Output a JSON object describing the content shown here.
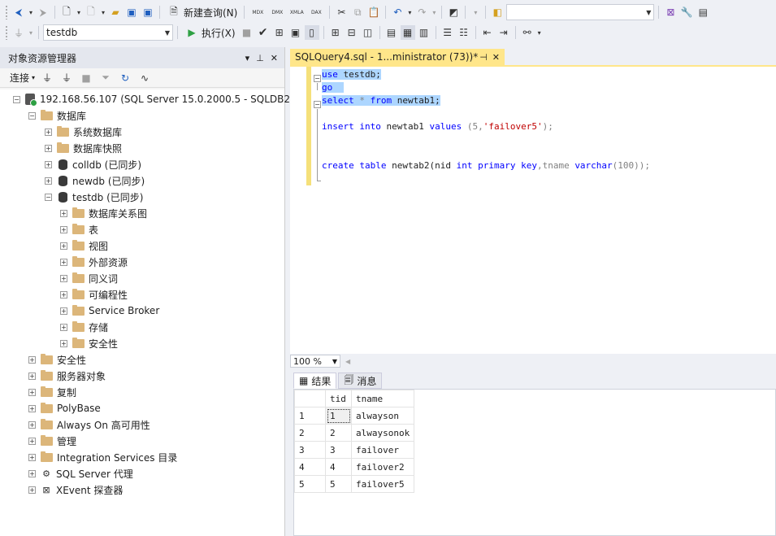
{
  "toolbar1": {
    "new_query_label": "新建查询(N)",
    "file_buttons": [
      "MDX",
      "DMX",
      "XMLA",
      "DAX"
    ],
    "search_value": ""
  },
  "toolbar2": {
    "database": "testdb",
    "execute_label": "执行(X)"
  },
  "object_explorer": {
    "title": "对象资源管理器",
    "connect_label": "连接",
    "tree": [
      {
        "label": "192.168.56.107 (SQL Server 15.0.2000.5 - SQLDB2\\A",
        "level": 0,
        "icon": "server-icon",
        "expanded": true
      },
      {
        "label": "数据库",
        "level": 1,
        "icon": "folder-icon",
        "expanded": true
      },
      {
        "label": "系统数据库",
        "level": 2,
        "icon": "folder-icon",
        "expanded": false
      },
      {
        "label": "数据库快照",
        "level": 2,
        "icon": "folder-icon",
        "expanded": false
      },
      {
        "label": "colldb (已同步)",
        "level": 2,
        "icon": "database-icon",
        "expanded": false
      },
      {
        "label": "newdb (已同步)",
        "level": 2,
        "icon": "database-icon",
        "expanded": false
      },
      {
        "label": "testdb (已同步)",
        "level": 2,
        "icon": "database-icon",
        "expanded": true
      },
      {
        "label": "数据库关系图",
        "level": 3,
        "icon": "folder-icon",
        "expanded": false
      },
      {
        "label": "表",
        "level": 3,
        "icon": "folder-icon",
        "expanded": false
      },
      {
        "label": "视图",
        "level": 3,
        "icon": "folder-icon",
        "expanded": false
      },
      {
        "label": "外部资源",
        "level": 3,
        "icon": "folder-icon",
        "expanded": false
      },
      {
        "label": "同义词",
        "level": 3,
        "icon": "folder-icon",
        "expanded": false
      },
      {
        "label": "可编程性",
        "level": 3,
        "icon": "folder-icon",
        "expanded": false
      },
      {
        "label": "Service Broker",
        "level": 3,
        "icon": "folder-icon",
        "expanded": false
      },
      {
        "label": "存储",
        "level": 3,
        "icon": "folder-icon",
        "expanded": false
      },
      {
        "label": "安全性",
        "level": 3,
        "icon": "folder-icon",
        "expanded": false
      },
      {
        "label": "安全性",
        "level": 1,
        "icon": "folder-icon",
        "expanded": false
      },
      {
        "label": "服务器对象",
        "level": 1,
        "icon": "folder-icon",
        "expanded": false
      },
      {
        "label": "复制",
        "level": 1,
        "icon": "folder-icon",
        "expanded": false
      },
      {
        "label": "PolyBase",
        "level": 1,
        "icon": "folder-icon",
        "expanded": false
      },
      {
        "label": "Always On 高可用性",
        "level": 1,
        "icon": "folder-icon",
        "expanded": false
      },
      {
        "label": "管理",
        "level": 1,
        "icon": "folder-icon",
        "expanded": false
      },
      {
        "label": "Integration Services 目录",
        "level": 1,
        "icon": "folder-icon",
        "expanded": false
      },
      {
        "label": "SQL Server 代理",
        "level": 1,
        "icon": "agent-icon",
        "expanded": false
      },
      {
        "label": "XEvent 探查器",
        "level": 1,
        "icon": "xevent-icon",
        "expanded": false
      }
    ]
  },
  "editor": {
    "tab_title": "SQLQuery4.sql - 1...ministrator (73))*",
    "lines": {
      "l1_kw": "use",
      "l1_rest": " testdb;",
      "l2_kw": "go",
      "l3_kw1": "select",
      "l3_star": " * ",
      "l3_kw2": "from",
      "l3_rest": " newtab1;",
      "l4_kw1": "insert",
      "l4_kw2": " into",
      "l4_mid": " newtab1 ",
      "l4_kw3": "values",
      "l4_p1": " (5,",
      "l4_str": "'failover5'",
      "l4_p2": ");",
      "l5_kw1": "create",
      "l5_kw2": " table",
      "l5_mid1": " newtab2(nid ",
      "l5_kw3": "int",
      "l5_kw4": " primary",
      "l5_kw5": " key",
      "l5_mid2": ",tname ",
      "l5_kw6": "varchar",
      "l5_p": "(100));"
    },
    "zoom": "100 %"
  },
  "results": {
    "results_tab": "结果",
    "messages_tab": "消息",
    "columns": [
      "tid",
      "tname"
    ],
    "rows": [
      {
        "n": "1",
        "tid": "1",
        "tname": "alwayson"
      },
      {
        "n": "2",
        "tid": "2",
        "tname": "alwaysonok"
      },
      {
        "n": "3",
        "tid": "3",
        "tname": "failover"
      },
      {
        "n": "4",
        "tid": "4",
        "tname": "failover2"
      },
      {
        "n": "5",
        "tid": "5",
        "tname": "failover5"
      }
    ]
  }
}
